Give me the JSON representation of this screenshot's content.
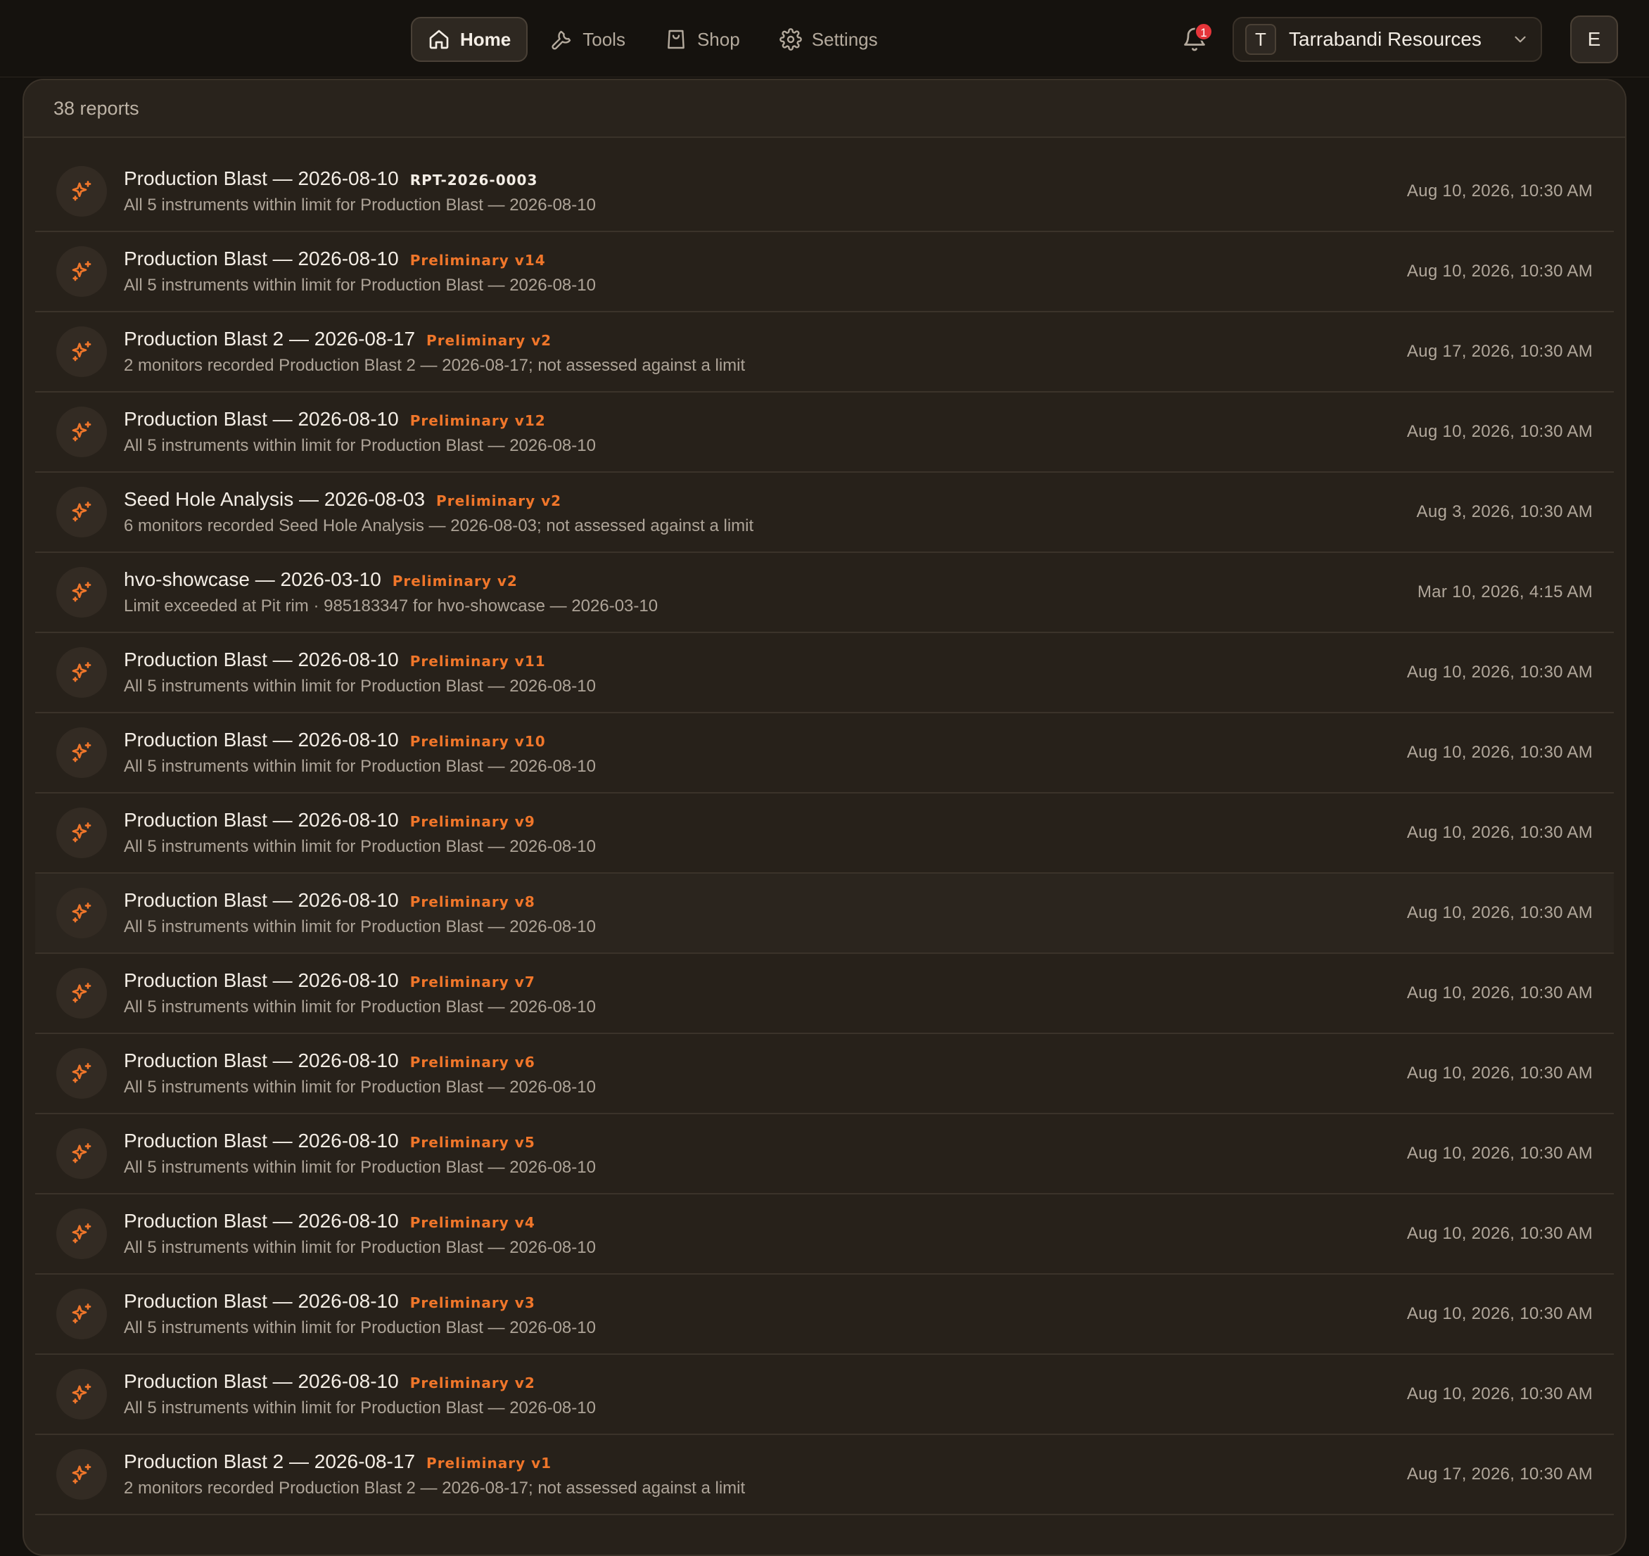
{
  "nav": {
    "items": [
      {
        "label": "Home",
        "icon": "home-icon",
        "active": true
      },
      {
        "label": "Tools",
        "icon": "wrench-icon",
        "active": false
      },
      {
        "label": "Shop",
        "icon": "shopping-bag-icon",
        "active": false
      },
      {
        "label": "Settings",
        "icon": "gear-icon",
        "active": false
      }
    ],
    "notifications_count": "1",
    "org": {
      "initial": "T",
      "name": "Tarrabandi Resources"
    },
    "user_initial": "E"
  },
  "colors": {
    "accent": "#f0762a",
    "badge": "#e5353a",
    "panel": "#27211a",
    "background": "#15120e"
  },
  "reports": {
    "count_label": "38 reports",
    "items": [
      {
        "title": "Production Blast — 2026-08-10",
        "tag": "RPT-2026-0003",
        "tag_style": "neutral",
        "subtitle": "All 5 instruments within limit for Production Blast — 2026-08-10",
        "date": "Aug 10, 2026, 10:30 AM",
        "icon": "sparkles-icon"
      },
      {
        "title": "Production Blast — 2026-08-10",
        "tag": "Preliminary v14",
        "tag_style": "accent",
        "subtitle": "All 5 instruments within limit for Production Blast — 2026-08-10",
        "date": "Aug 10, 2026, 10:30 AM",
        "icon": "sparkles-icon"
      },
      {
        "title": "Production Blast 2 — 2026-08-17",
        "tag": "Preliminary v2",
        "tag_style": "accent",
        "subtitle": "2 monitors recorded Production Blast 2 — 2026-08-17; not assessed against a limit",
        "date": "Aug 17, 2026, 10:30 AM",
        "icon": "sparkles-icon"
      },
      {
        "title": "Production Blast — 2026-08-10",
        "tag": "Preliminary v12",
        "tag_style": "accent",
        "subtitle": "All 5 instruments within limit for Production Blast — 2026-08-10",
        "date": "Aug 10, 2026, 10:30 AM",
        "icon": "sparkles-icon"
      },
      {
        "title": "Seed Hole Analysis — 2026-08-03",
        "tag": "Preliminary v2",
        "tag_style": "accent",
        "subtitle": "6 monitors recorded Seed Hole Analysis — 2026-08-03; not assessed against a limit",
        "date": "Aug 3, 2026, 10:30 AM",
        "icon": "sparkles-icon"
      },
      {
        "title": "hvo-showcase — 2026-03-10",
        "tag": "Preliminary v2",
        "tag_style": "accent",
        "subtitle": "Limit exceeded at Pit rim · 985183347 for hvo-showcase — 2026-03-10",
        "date": "Mar 10, 2026, 4:15 AM",
        "icon": "sparkles-icon"
      },
      {
        "title": "Production Blast — 2026-08-10",
        "tag": "Preliminary v11",
        "tag_style": "accent",
        "subtitle": "All 5 instruments within limit for Production Blast — 2026-08-10",
        "date": "Aug 10, 2026, 10:30 AM",
        "icon": "sparkles-icon"
      },
      {
        "title": "Production Blast — 2026-08-10",
        "tag": "Preliminary v10",
        "tag_style": "accent",
        "subtitle": "All 5 instruments within limit for Production Blast — 2026-08-10",
        "date": "Aug 10, 2026, 10:30 AM",
        "icon": "sparkles-icon"
      },
      {
        "title": "Production Blast — 2026-08-10",
        "tag": "Preliminary v9",
        "tag_style": "accent",
        "subtitle": "All 5 instruments within limit for Production Blast — 2026-08-10",
        "date": "Aug 10, 2026, 10:30 AM",
        "icon": "sparkles-icon"
      },
      {
        "title": "Production Blast — 2026-08-10",
        "tag": "Preliminary v8",
        "tag_style": "accent",
        "subtitle": "All 5 instruments within limit for Production Blast — 2026-08-10",
        "date": "Aug 10, 2026, 10:30 AM",
        "icon": "sparkles-icon",
        "hover": true
      },
      {
        "title": "Production Blast — 2026-08-10",
        "tag": "Preliminary v7",
        "tag_style": "accent",
        "subtitle": "All 5 instruments within limit for Production Blast — 2026-08-10",
        "date": "Aug 10, 2026, 10:30 AM",
        "icon": "sparkles-icon"
      },
      {
        "title": "Production Blast — 2026-08-10",
        "tag": "Preliminary v6",
        "tag_style": "accent",
        "subtitle": "All 5 instruments within limit for Production Blast — 2026-08-10",
        "date": "Aug 10, 2026, 10:30 AM",
        "icon": "sparkles-icon"
      },
      {
        "title": "Production Blast — 2026-08-10",
        "tag": "Preliminary v5",
        "tag_style": "accent",
        "subtitle": "All 5 instruments within limit for Production Blast — 2026-08-10",
        "date": "Aug 10, 2026, 10:30 AM",
        "icon": "sparkles-icon"
      },
      {
        "title": "Production Blast — 2026-08-10",
        "tag": "Preliminary v4",
        "tag_style": "accent",
        "subtitle": "All 5 instruments within limit for Production Blast — 2026-08-10",
        "date": "Aug 10, 2026, 10:30 AM",
        "icon": "sparkles-icon"
      },
      {
        "title": "Production Blast — 2026-08-10",
        "tag": "Preliminary v3",
        "tag_style": "accent",
        "subtitle": "All 5 instruments within limit for Production Blast — 2026-08-10",
        "date": "Aug 10, 2026, 10:30 AM",
        "icon": "sparkles-icon"
      },
      {
        "title": "Production Blast — 2026-08-10",
        "tag": "Preliminary v2",
        "tag_style": "accent",
        "subtitle": "All 5 instruments within limit for Production Blast — 2026-08-10",
        "date": "Aug 10, 2026, 10:30 AM",
        "icon": "sparkles-icon"
      },
      {
        "title": "Production Blast 2 — 2026-08-17",
        "tag": "Preliminary v1",
        "tag_style": "accent",
        "subtitle": "2 monitors recorded Production Blast 2 — 2026-08-17; not assessed against a limit",
        "date": "Aug 17, 2026, 10:30 AM",
        "icon": "sparkles-icon"
      }
    ]
  }
}
